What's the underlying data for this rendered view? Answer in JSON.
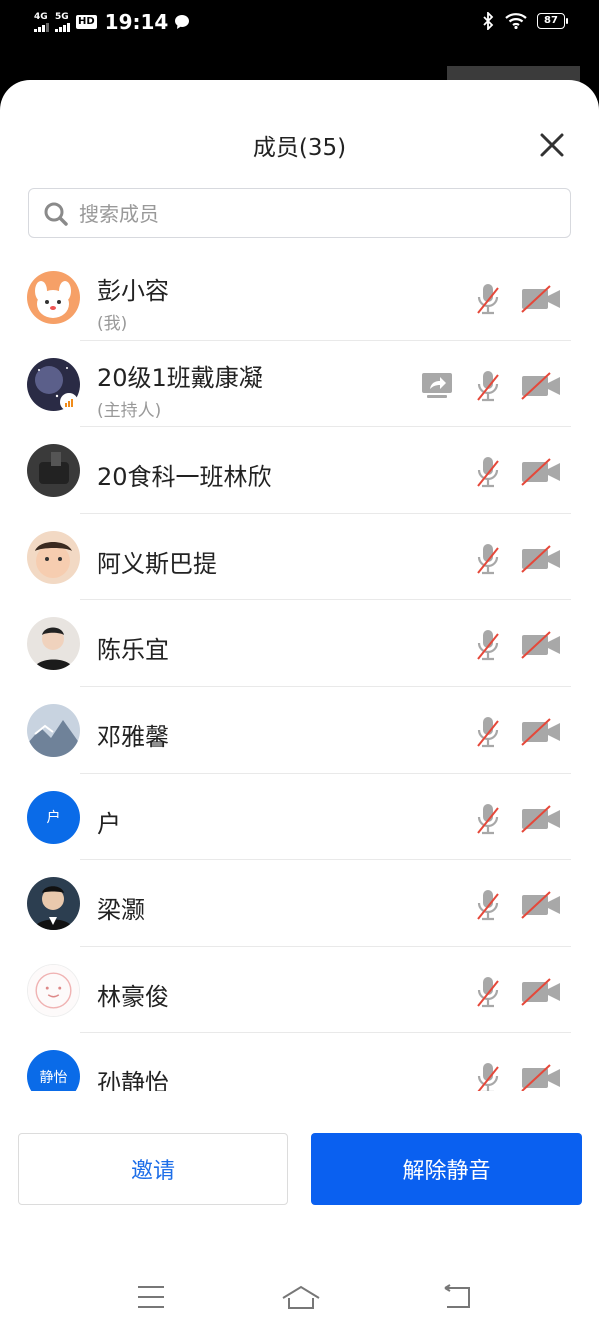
{
  "status_bar": {
    "signal1_label": "4G",
    "signal2_label": "5G",
    "hd_label": "HD",
    "time": "19:14",
    "battery": "87"
  },
  "panel": {
    "title": "成员(35)",
    "search_placeholder": "搜索成员"
  },
  "members": [
    {
      "name": "彭小容",
      "role": "(我)"
    },
    {
      "name": "20级1班戴康凝",
      "role": "(主持人)"
    },
    {
      "name": "20食科一班林欣"
    },
    {
      "name": "阿义斯巴提"
    },
    {
      "name": "陈乐宜"
    },
    {
      "name": "邓雅馨"
    },
    {
      "name": "户",
      "avatar_text": "户"
    },
    {
      "name": "梁灏"
    },
    {
      "name": "林豪俊"
    },
    {
      "name": "孙静怡",
      "avatar_text": "静怡"
    }
  ],
  "buttons": {
    "invite": "邀请",
    "unmute": "解除静音"
  },
  "colors": {
    "accent": "#0A60F0",
    "muted_slash": "#E5483A"
  }
}
